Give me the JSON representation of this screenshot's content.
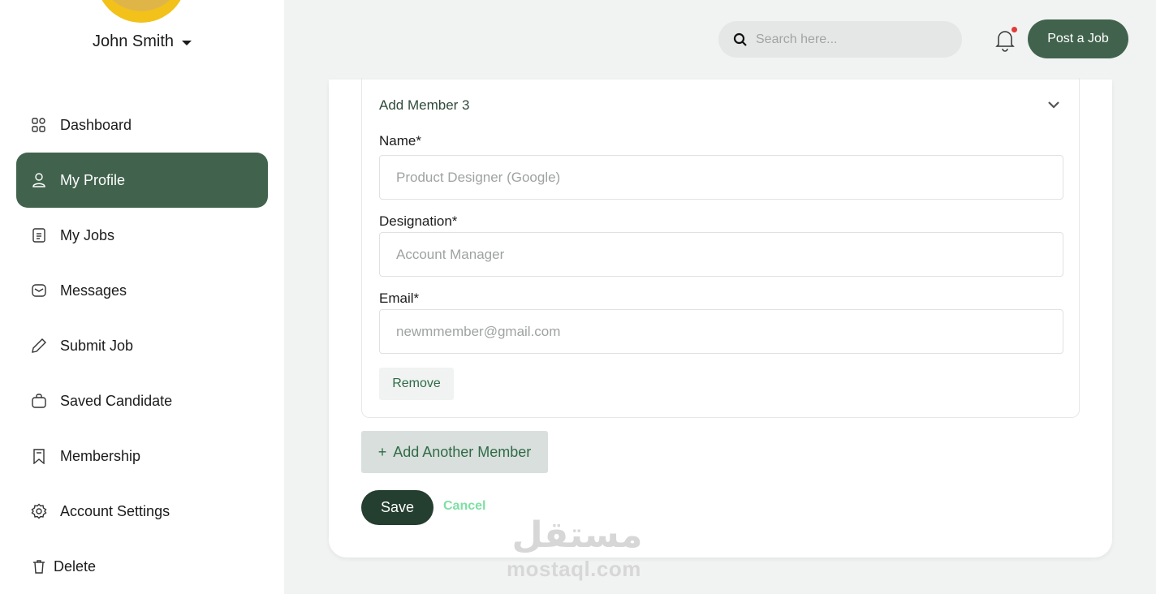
{
  "user": {
    "name": "John Smith"
  },
  "sidebar": {
    "items": [
      {
        "label": "Dashboard",
        "icon": "grid-icon",
        "active": false
      },
      {
        "label": "My Profile",
        "icon": "user-icon",
        "active": true
      },
      {
        "label": "My Jobs",
        "icon": "document-icon",
        "active": false
      },
      {
        "label": "Messages",
        "icon": "envelope-icon",
        "active": false
      },
      {
        "label": "Submit Job",
        "icon": "pencil-icon",
        "active": false
      },
      {
        "label": "Saved Candidate",
        "icon": "briefcase-icon",
        "active": false
      },
      {
        "label": "Membership",
        "icon": "bookmark-icon",
        "active": false
      },
      {
        "label": "Account Settings",
        "icon": "gear-icon",
        "active": false
      },
      {
        "label": "Delete",
        "icon": "trash-icon",
        "active": false
      }
    ]
  },
  "header": {
    "search_placeholder": "Search here...",
    "post_job_label": "Post a Job"
  },
  "member_form": {
    "title": "Add Member 3",
    "name_label": "Name*",
    "name_placeholder": "Product Designer (Google)",
    "designation_label": "Designation*",
    "designation_placeholder": "Account Manager",
    "email_label": "Email*",
    "email_placeholder": "newmmember@gmail.com",
    "remove_label": "Remove"
  },
  "actions": {
    "add_member_label": "Add Another Member",
    "save_label": "Save",
    "cancel_label": "Cancel"
  },
  "watermark": {
    "text": "mostaql.com",
    "arabic": "مستقل"
  },
  "colors": {
    "primary": "#41634d",
    "dark": "#243e30",
    "accent_text": "#2f6b47",
    "cancel": "#7ee0a3",
    "notification_dot": "#e23b3b"
  }
}
